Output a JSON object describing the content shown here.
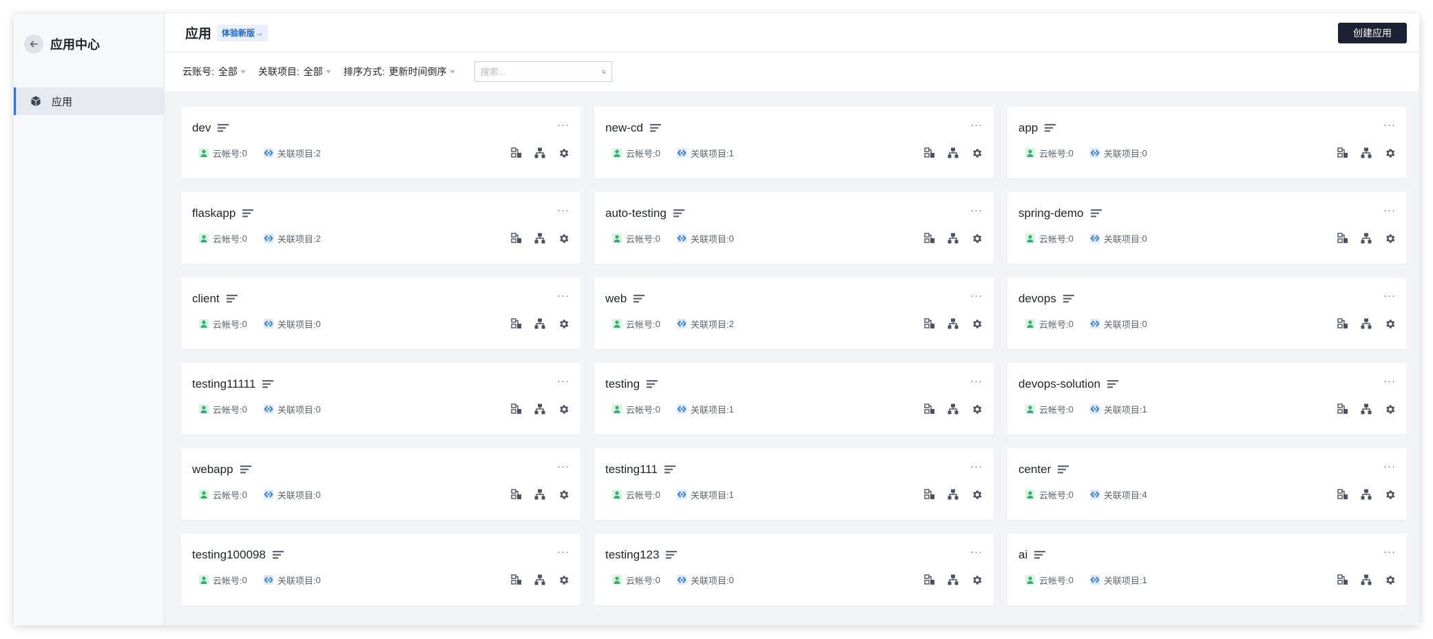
{
  "sidebar": {
    "title": "应用中心",
    "items": [
      {
        "label": "应用"
      }
    ]
  },
  "header": {
    "title": "应用",
    "badge": "体验新版→",
    "create_button": "创建应用"
  },
  "filters": {
    "cloud_account_label": "云账号:",
    "cloud_account_value": "全部",
    "project_label": "关联项目:",
    "project_value": "全部",
    "sort_label": "排序方式:",
    "sort_value": "更新时间倒序",
    "search_placeholder": "搜索..."
  },
  "card_labels": {
    "cloud": "云帐号: ",
    "project": "关联项目: "
  },
  "apps": [
    {
      "name": "dev",
      "cloud": "0",
      "projects": "2"
    },
    {
      "name": "new-cd",
      "cloud": "0",
      "projects": "1"
    },
    {
      "name": "app",
      "cloud": "0",
      "projects": "0"
    },
    {
      "name": "flaskapp",
      "cloud": "0",
      "projects": "2"
    },
    {
      "name": "auto-testing",
      "cloud": "0",
      "projects": "0"
    },
    {
      "name": "spring-demo",
      "cloud": "0",
      "projects": "0"
    },
    {
      "name": "client",
      "cloud": "0",
      "projects": "0"
    },
    {
      "name": "web",
      "cloud": "0",
      "projects": "2"
    },
    {
      "name": "devops",
      "cloud": "0",
      "projects": "0"
    },
    {
      "name": "testing11111",
      "cloud": "0",
      "projects": "0"
    },
    {
      "name": "testing",
      "cloud": "0",
      "projects": "1"
    },
    {
      "name": "devops-solution",
      "cloud": "0",
      "projects": "1"
    },
    {
      "name": "webapp",
      "cloud": "0",
      "projects": "0"
    },
    {
      "name": "testing111",
      "cloud": "0",
      "projects": "1"
    },
    {
      "name": "center",
      "cloud": "0",
      "projects": "4"
    },
    {
      "name": "testing100098",
      "cloud": "0",
      "projects": "0"
    },
    {
      "name": "testing123",
      "cloud": "0",
      "projects": "0"
    },
    {
      "name": "ai",
      "cloud": "0",
      "projects": "1"
    }
  ],
  "icons": {
    "back": "arrow-left-icon",
    "nav": "cube-icon",
    "search": "search-icon",
    "desc": "description-icon",
    "cloud": "user-icon",
    "project": "link-icon",
    "actions": [
      "resource-icon",
      "topology-icon",
      "gear-icon"
    ]
  },
  "colors": {
    "accent": "#2b6ef2",
    "primary_button": "#1c2233",
    "cloud_icon": "#3cc27a",
    "project_icon": "#2b7de9"
  }
}
